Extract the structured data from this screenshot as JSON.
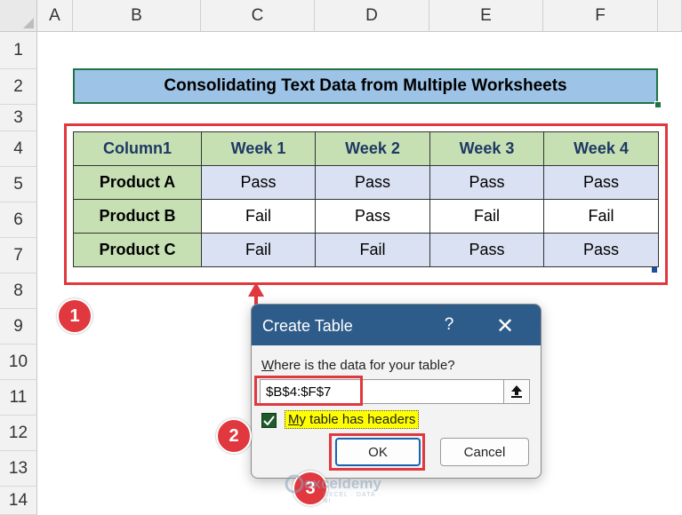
{
  "sheet": {
    "columns": [
      "A",
      "B",
      "C",
      "D",
      "E",
      "F"
    ],
    "rows": [
      "1",
      "2",
      "3",
      "4",
      "5",
      "6",
      "7",
      "8",
      "9",
      "10",
      "11",
      "12",
      "13",
      "14"
    ]
  },
  "title": "Consolidating Text Data from Multiple Worksheets",
  "table": {
    "headers": [
      "Column1",
      "Week 1",
      "Week 2",
      "Week 3",
      "Week 4"
    ],
    "rows": [
      [
        "Product A",
        "Pass",
        "Pass",
        "Pass",
        "Pass"
      ],
      [
        "Product B",
        "Fail",
        "Pass",
        "Fail",
        "Fail"
      ],
      [
        "Product C",
        "Fail",
        "Fail",
        "Pass",
        "Pass"
      ]
    ]
  },
  "dialog": {
    "title": "Create Table",
    "help": "?",
    "close": "✕",
    "prompt_underline": "W",
    "prompt_rest": "here is the data for your table?",
    "range": "$B$4:$F$7",
    "checkbox_checked": true,
    "checkbox_underline": "M",
    "checkbox_rest": "y table has headers",
    "ok": "OK",
    "cancel": "Cancel"
  },
  "markers": [
    "1",
    "2",
    "3"
  ],
  "watermark": {
    "name": "exceldemy",
    "tagline": "EXCEL · DATA · BI"
  },
  "colors": {
    "accent_red": "#e0383e",
    "dialog_title": "#2e5c8a",
    "header_green": "#c6e0b4",
    "row_blue": "#d9e1f2",
    "title_blue": "#9dc3e6"
  }
}
